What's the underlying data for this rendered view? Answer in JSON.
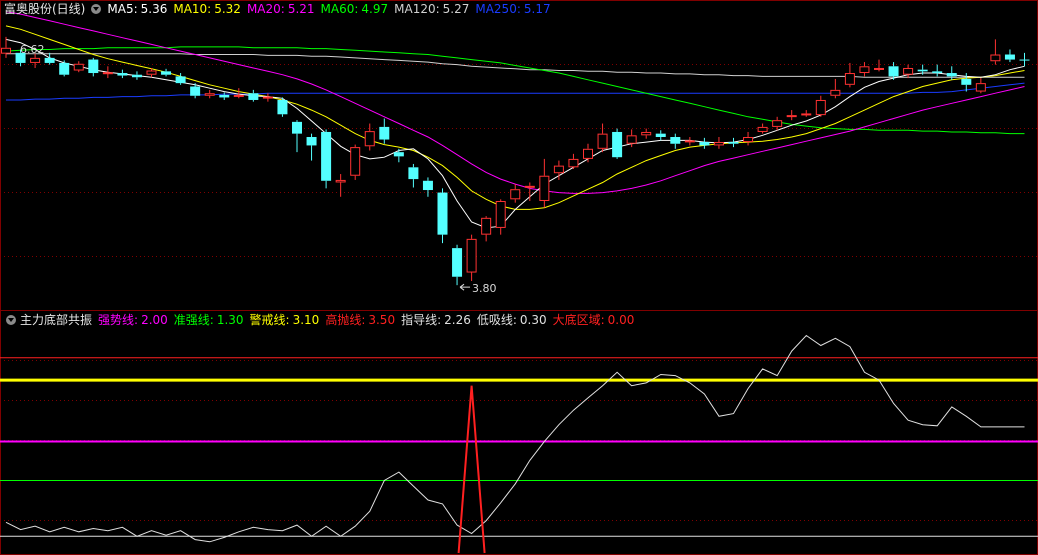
{
  "main_header": {
    "title": "富奥股份(日线)",
    "indicators": [
      {
        "label": "MA5:",
        "value": "5.36",
        "color": "#ffffff"
      },
      {
        "label": "MA10:",
        "value": "5.32",
        "color": "#ffff00"
      },
      {
        "label": "MA20:",
        "value": "5.21",
        "color": "#ff00ff"
      },
      {
        "label": "MA60:",
        "value": "4.97",
        "color": "#00ff00"
      },
      {
        "label": "MA120:",
        "value": "5.27",
        "color": "#d0d0d0"
      },
      {
        "label": "MA250:",
        "value": "5.17",
        "color": "#1a3cff"
      }
    ]
  },
  "indicator_header": {
    "title": "主力底部共振",
    "indicators": [
      {
        "label": "强势线:",
        "value": "2.00",
        "color": "#ff00ff"
      },
      {
        "label": "准强线:",
        "value": "1.30",
        "color": "#00ff00"
      },
      {
        "label": "警戒线:",
        "value": "3.10",
        "color": "#ffff00"
      },
      {
        "label": "高抛线:",
        "value": "3.50",
        "color": "#ff2020"
      },
      {
        "label": "指导线:",
        "value": "2.26",
        "color": "#e0e0e0"
      },
      {
        "label": "低吸线:",
        "value": "0.30",
        "color": "#e0e0e0"
      },
      {
        "label": "大底区域:",
        "value": "0.00",
        "color": "#ff2020"
      }
    ]
  },
  "colors": {
    "up": "#ff3232",
    "down": "#54ffff",
    "grid": "#800000",
    "ma5": "#ffffff",
    "ma10": "#ffff00",
    "ma20": "#ff00ff",
    "ma60": "#00ff00",
    "ma120": "#d0d0d0",
    "ma250": "#1a3cff"
  },
  "chart_data": [
    {
      "type": "candlestick",
      "price_range": [
        3.6,
        6.95
      ],
      "annotations": [
        {
          "text": "6.62",
          "price": 6.62,
          "candle_index": 0
        },
        {
          "text": "3.80",
          "price": 3.8,
          "candle_index": 31
        }
      ],
      "candles": [
        [
          6.55,
          6.62,
          6.75,
          6.5
        ],
        [
          6.56,
          6.44,
          6.6,
          6.4
        ],
        [
          6.44,
          6.5,
          6.55,
          6.38
        ],
        [
          6.5,
          6.44,
          6.56,
          6.42
        ],
        [
          6.44,
          6.3,
          6.47,
          6.28
        ],
        [
          6.35,
          6.43,
          6.46,
          6.33
        ],
        [
          6.48,
          6.32,
          6.5,
          6.28
        ],
        [
          6.32,
          6.33,
          6.4,
          6.26
        ],
        [
          6.32,
          6.29,
          6.36,
          6.26
        ],
        [
          6.3,
          6.27,
          6.34,
          6.24
        ],
        [
          6.3,
          6.35,
          6.38,
          6.27
        ],
        [
          6.34,
          6.3,
          6.37,
          6.28
        ],
        [
          6.28,
          6.2,
          6.32,
          6.18
        ],
        [
          6.16,
          6.05,
          6.2,
          6.02
        ],
        [
          6.05,
          6.08,
          6.12,
          6.02
        ],
        [
          6.06,
          6.03,
          6.09,
          6.0
        ],
        [
          6.06,
          6.06,
          6.14,
          6.02
        ],
        [
          6.08,
          6.0,
          6.12,
          5.98
        ],
        [
          6.02,
          6.04,
          6.08,
          5.98
        ],
        [
          6.0,
          5.83,
          6.03,
          5.8
        ],
        [
          5.74,
          5.6,
          5.76,
          5.38
        ],
        [
          5.56,
          5.46,
          5.6,
          5.28
        ],
        [
          5.62,
          5.04,
          5.65,
          4.95
        ],
        [
          5.02,
          5.05,
          5.12,
          4.85
        ],
        [
          5.1,
          5.44,
          5.47,
          5.05
        ],
        [
          5.45,
          5.63,
          5.72,
          5.4
        ],
        [
          5.68,
          5.53,
          5.78,
          5.48
        ],
        [
          5.38,
          5.33,
          5.42,
          5.26
        ],
        [
          5.2,
          5.06,
          5.24,
          4.96
        ],
        [
          5.04,
          4.93,
          5.08,
          4.85
        ],
        [
          4.9,
          4.4,
          4.95,
          4.3
        ],
        [
          4.24,
          3.9,
          4.28,
          3.8
        ],
        [
          3.95,
          4.35,
          4.4,
          3.85
        ],
        [
          4.4,
          4.6,
          4.62,
          4.32
        ],
        [
          4.48,
          4.8,
          4.82,
          4.4
        ],
        [
          4.82,
          4.94,
          5.0,
          4.78
        ],
        [
          4.96,
          4.98,
          5.02,
          4.8
        ],
        [
          4.8,
          5.1,
          5.3,
          4.72
        ],
        [
          5.13,
          5.22,
          5.28,
          5.05
        ],
        [
          5.2,
          5.3,
          5.36,
          5.18
        ],
        [
          5.3,
          5.42,
          5.48,
          5.26
        ],
        [
          5.42,
          5.6,
          5.72,
          5.38
        ],
        [
          5.62,
          5.32,
          5.66,
          5.3
        ],
        [
          5.48,
          5.58,
          5.65,
          5.44
        ],
        [
          5.58,
          5.62,
          5.66,
          5.54
        ],
        [
          5.6,
          5.56,
          5.64,
          5.52
        ],
        [
          5.56,
          5.48,
          5.6,
          5.42
        ],
        [
          5.5,
          5.52,
          5.56,
          5.46
        ],
        [
          5.5,
          5.46,
          5.55,
          5.42
        ],
        [
          5.46,
          5.5,
          5.56,
          5.42
        ],
        [
          5.5,
          5.48,
          5.55,
          5.44
        ],
        [
          5.5,
          5.56,
          5.62,
          5.46
        ],
        [
          5.62,
          5.68,
          5.72,
          5.6
        ],
        [
          5.68,
          5.76,
          5.8,
          5.64
        ],
        [
          5.8,
          5.82,
          5.88,
          5.76
        ],
        [
          5.82,
          5.84,
          5.88,
          5.8
        ],
        [
          5.82,
          6.0,
          6.05,
          5.8
        ],
        [
          6.05,
          6.12,
          6.25,
          6.02
        ],
        [
          6.18,
          6.32,
          6.44,
          6.15
        ],
        [
          6.32,
          6.4,
          6.45,
          6.28
        ],
        [
          6.36,
          6.38,
          6.48,
          6.34
        ],
        [
          6.4,
          6.28,
          6.45,
          6.24
        ],
        [
          6.3,
          6.38,
          6.42,
          6.26
        ],
        [
          6.36,
          6.34,
          6.42,
          6.3
        ],
        [
          6.34,
          6.32,
          6.42,
          6.28
        ],
        [
          6.32,
          6.28,
          6.4,
          6.24
        ],
        [
          6.25,
          6.18,
          6.32,
          6.1
        ],
        [
          6.1,
          6.2,
          6.26,
          6.08
        ],
        [
          6.46,
          6.54,
          6.72,
          6.42
        ],
        [
          6.54,
          6.48,
          6.6,
          6.45
        ],
        [
          6.48,
          6.47,
          6.56,
          6.4
        ]
      ],
      "ma_lines": {
        "ma5": [
          6.72,
          6.68,
          6.6,
          6.5,
          6.44,
          6.4,
          6.36,
          6.33,
          6.31,
          6.29,
          6.27,
          6.24,
          6.21,
          6.18,
          6.14,
          6.1,
          6.07,
          6.05,
          6.04,
          6.02,
          5.9,
          5.75,
          5.6,
          5.45,
          5.35,
          5.3,
          5.32,
          5.4,
          5.42,
          5.3,
          5.1,
          4.8,
          4.55,
          4.48,
          4.5,
          4.7,
          4.85,
          5.0,
          5.1,
          5.2,
          5.3,
          5.4,
          5.44,
          5.48,
          5.5,
          5.52,
          5.52,
          5.52,
          5.5,
          5.49,
          5.5,
          5.53,
          5.58,
          5.64,
          5.7,
          5.75,
          5.82,
          5.92,
          6.04,
          6.15,
          6.22,
          6.26,
          6.3,
          6.32,
          6.32,
          6.3,
          6.28,
          6.27,
          6.3,
          6.36,
          6.4
        ],
        "ma10": [
          6.88,
          6.84,
          6.78,
          6.72,
          6.66,
          6.6,
          6.54,
          6.49,
          6.45,
          6.41,
          6.37,
          6.33,
          6.28,
          6.23,
          6.18,
          6.14,
          6.1,
          6.07,
          6.04,
          6.0,
          5.95,
          5.88,
          5.8,
          5.7,
          5.6,
          5.52,
          5.47,
          5.44,
          5.4,
          5.32,
          5.22,
          5.08,
          4.92,
          4.82,
          4.74,
          4.7,
          4.7,
          4.72,
          4.78,
          4.86,
          4.94,
          5.02,
          5.12,
          5.2,
          5.28,
          5.34,
          5.4,
          5.44,
          5.46,
          5.48,
          5.49,
          5.5,
          5.51,
          5.53,
          5.56,
          5.6,
          5.66,
          5.72,
          5.8,
          5.88,
          5.96,
          6.04,
          6.1,
          6.16,
          6.2,
          6.24,
          6.26,
          6.27,
          6.29,
          6.32,
          6.35
        ],
        "ma20": [
          7.05,
          7.02,
          6.98,
          6.94,
          6.9,
          6.86,
          6.82,
          6.78,
          6.74,
          6.7,
          6.66,
          6.62,
          6.58,
          6.54,
          6.5,
          6.46,
          6.42,
          6.38,
          6.34,
          6.3,
          6.25,
          6.19,
          6.12,
          6.04,
          5.96,
          5.88,
          5.8,
          5.72,
          5.64,
          5.56,
          5.46,
          5.35,
          5.24,
          5.14,
          5.06,
          5.0,
          4.95,
          4.92,
          4.9,
          4.89,
          4.89,
          4.9,
          4.92,
          4.95,
          4.99,
          5.04,
          5.1,
          5.16,
          5.22,
          5.27,
          5.31,
          5.35,
          5.39,
          5.43,
          5.47,
          5.51,
          5.55,
          5.59,
          5.63,
          5.68,
          5.73,
          5.78,
          5.83,
          5.88,
          5.92,
          5.96,
          6.0,
          6.04,
          6.08,
          6.12,
          6.16
        ],
        "ma60": [
          6.58,
          6.59,
          6.6,
          6.6,
          6.61,
          6.61,
          6.61,
          6.62,
          6.62,
          6.62,
          6.62,
          6.62,
          6.63,
          6.63,
          6.63,
          6.63,
          6.63,
          6.62,
          6.62,
          6.62,
          6.62,
          6.61,
          6.61,
          6.6,
          6.59,
          6.58,
          6.57,
          6.56,
          6.55,
          6.54,
          6.52,
          6.5,
          6.48,
          6.46,
          6.44,
          6.41,
          6.38,
          6.35,
          6.32,
          6.28,
          6.24,
          6.2,
          6.16,
          6.12,
          6.08,
          6.04,
          6.0,
          5.96,
          5.92,
          5.88,
          5.84,
          5.8,
          5.77,
          5.74,
          5.71,
          5.69,
          5.67,
          5.66,
          5.65,
          5.65,
          5.64,
          5.64,
          5.64,
          5.63,
          5.63,
          5.62,
          5.62,
          5.61,
          5.61,
          5.6,
          5.6
        ],
        "ma120": [
          6.55,
          6.55,
          6.55,
          6.55,
          6.55,
          6.55,
          6.55,
          6.55,
          6.55,
          6.55,
          6.55,
          6.55,
          6.55,
          6.54,
          6.54,
          6.54,
          6.54,
          6.54,
          6.53,
          6.53,
          6.53,
          6.52,
          6.52,
          6.51,
          6.5,
          6.49,
          6.48,
          6.47,
          6.46,
          6.45,
          6.43,
          6.42,
          6.4,
          6.39,
          6.38,
          6.37,
          6.36,
          6.36,
          6.35,
          6.35,
          6.34,
          6.34,
          6.33,
          6.33,
          6.32,
          6.32,
          6.31,
          6.31,
          6.3,
          6.3,
          6.29,
          6.29,
          6.28,
          6.28,
          6.28,
          6.28,
          6.28,
          6.28,
          6.28,
          6.27,
          6.27,
          6.27,
          6.27,
          6.27,
          6.27,
          6.27,
          6.27,
          6.27,
          6.27,
          6.27,
          6.27
        ],
        "ma250": [
          6.0,
          6.0,
          6.01,
          6.01,
          6.02,
          6.02,
          6.03,
          6.03,
          6.04,
          6.04,
          6.05,
          6.05,
          6.06,
          6.06,
          6.06,
          6.07,
          6.07,
          6.07,
          6.08,
          6.08,
          6.08,
          6.08,
          6.08,
          6.08,
          6.08,
          6.08,
          6.08,
          6.08,
          6.08,
          6.08,
          6.08,
          6.08,
          6.08,
          6.08,
          6.08,
          6.08,
          6.08,
          6.08,
          6.08,
          6.08,
          6.08,
          6.08,
          6.08,
          6.08,
          6.08,
          6.08,
          6.08,
          6.08,
          6.08,
          6.08,
          6.08,
          6.08,
          6.08,
          6.08,
          6.08,
          6.08,
          6.08,
          6.08,
          6.08,
          6.08,
          6.08,
          6.08,
          6.08,
          6.09,
          6.09,
          6.1,
          6.12,
          6.14,
          6.16,
          6.18,
          6.2
        ]
      }
    },
    {
      "type": "line",
      "y_range": [
        0.0,
        3.98
      ],
      "horizontal_lines": [
        {
          "name": "高抛线",
          "value": 3.5,
          "color": "#ff2020"
        },
        {
          "name": "警戒线",
          "value": 3.1,
          "color": "#ffff00"
        },
        {
          "name": "强势线",
          "value": 2.0,
          "color": "#ff00ff"
        },
        {
          "name": "准强线",
          "value": 1.3,
          "color": "#00ff00"
        },
        {
          "name": "低吸线",
          "value": 0.3,
          "color": "#e0e0e0"
        }
      ],
      "guide_line": [
        0.55,
        0.42,
        0.48,
        0.38,
        0.46,
        0.38,
        0.44,
        0.4,
        0.46,
        0.3,
        0.4,
        0.32,
        0.4,
        0.24,
        0.2,
        0.28,
        0.38,
        0.46,
        0.42,
        0.4,
        0.5,
        0.3,
        0.48,
        0.3,
        0.48,
        0.75,
        1.3,
        1.45,
        1.2,
        0.95,
        0.88,
        0.5,
        0.35,
        0.58,
        0.9,
        1.24,
        1.66,
        2.0,
        2.3,
        2.56,
        2.78,
        3.0,
        3.24,
        3.0,
        3.05,
        3.2,
        3.18,
        3.05,
        2.85,
        2.45,
        2.5,
        2.95,
        3.3,
        3.18,
        3.62,
        3.9,
        3.72,
        3.85,
        3.7,
        3.24,
        3.1,
        2.68,
        2.38,
        2.3,
        2.28,
        2.62,
        2.45,
        2.26,
        2.26,
        2.26,
        2.26
      ],
      "bottom_zone": {
        "name": "大底区域",
        "value": 0.0,
        "spike_index": 32,
        "spike_value": 3.0
      }
    }
  ]
}
